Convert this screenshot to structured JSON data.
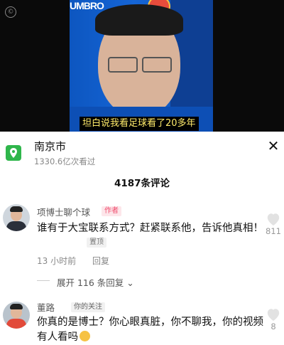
{
  "video": {
    "subtitle": "坦白说我看足球看了20多年",
    "brand_text": "UMBRO"
  },
  "location": {
    "title": "南京市",
    "views": "1330.6亿次看过"
  },
  "comments_header": {
    "count_label": "4187条评论"
  },
  "comments": [
    {
      "author": "项博士聊个球",
      "badge": "作者",
      "text": "谁有于大宝联系方式？赶紧联系他，告诉他真相！",
      "pin": "置顶",
      "time": "13 小时前",
      "reply": "回复",
      "likes": "811",
      "expand": "展开 116 条回复"
    },
    {
      "author": "董路",
      "badge": "你的关注",
      "text": "你真的是博士？你心眼真脏，你不聊我，你的视频有人看吗",
      "likes": "8"
    }
  ],
  "colors": {
    "location_icon": "#2fb64b",
    "author_badge_text": "#ef4b6c",
    "subtitle_text": "#ffeb6b"
  }
}
